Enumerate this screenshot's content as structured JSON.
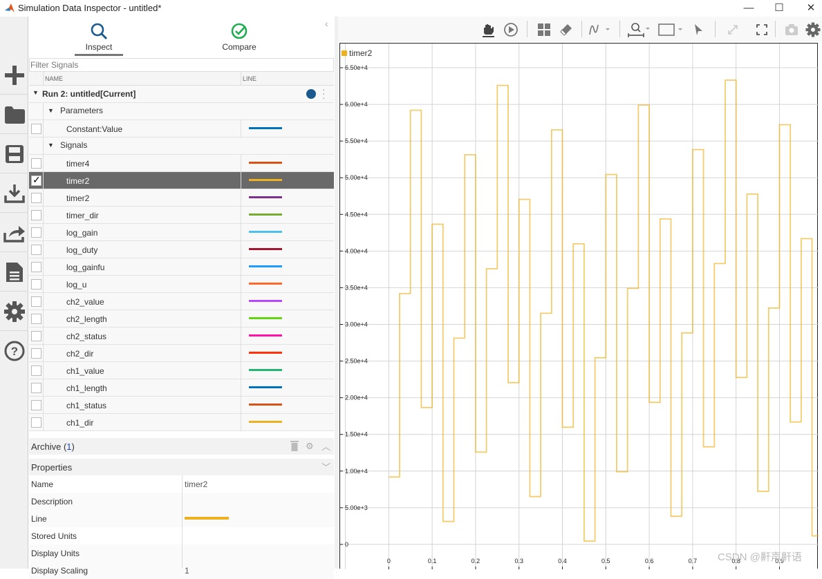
{
  "window": {
    "title": "Simulation Data Inspector - untitled*",
    "minimize": "—",
    "maximize": "☐",
    "close": "✕"
  },
  "sidebar": {
    "icons": [
      "plus-icon",
      "folder-icon",
      "save-icon",
      "download-icon",
      "share-icon",
      "document-icon",
      "gear-icon",
      "help-icon"
    ]
  },
  "tabs": [
    {
      "label": "Inspect",
      "icon": "search-icon",
      "active": true
    },
    {
      "label": "Compare",
      "icon": "check-circle-icon",
      "active": false
    }
  ],
  "filter": {
    "placeholder": "Filter Signals"
  },
  "table": {
    "col_name": "NAME",
    "col_line": "LINE"
  },
  "run": {
    "label": "Run 2: untitled[Current]",
    "dot_color": "#1a5a8f"
  },
  "groups": {
    "parameters": "Parameters",
    "signals": "Signals"
  },
  "parameters": [
    {
      "name": "Constant:Value",
      "color": "#0072bd",
      "checked": false
    }
  ],
  "signals": [
    {
      "name": "timer4",
      "color": "#d95319",
      "checked": false
    },
    {
      "name": "timer2",
      "color": "#edb120",
      "checked": true
    },
    {
      "name": "timer2",
      "color": "#7e2f8e",
      "checked": false
    },
    {
      "name": "timer_dir",
      "color": "#77ac30",
      "checked": false
    },
    {
      "name": "log_gain",
      "color": "#4dbeee",
      "checked": false
    },
    {
      "name": "log_duty",
      "color": "#a2142f",
      "checked": false
    },
    {
      "name": "log_gainfu",
      "color": "#1e9bff",
      "checked": false
    },
    {
      "name": "log_u",
      "color": "#ff6929",
      "checked": false
    },
    {
      "name": "ch2_value",
      "color": "#b746ff",
      "checked": false
    },
    {
      "name": "ch2_length",
      "color": "#64d413",
      "checked": false
    },
    {
      "name": "ch2_status",
      "color": "#ff13a6",
      "checked": false
    },
    {
      "name": "ch2_dir",
      "color": "#fe330a",
      "checked": false
    },
    {
      "name": "ch1_value",
      "color": "#22b573",
      "checked": false
    },
    {
      "name": "ch1_length",
      "color": "#0072bd",
      "checked": false
    },
    {
      "name": "ch1_status",
      "color": "#d95319",
      "checked": false
    },
    {
      "name": "ch1_dir",
      "color": "#edb120",
      "checked": false
    }
  ],
  "archive": {
    "label": "Archive (",
    "count": "1",
    "close": ")"
  },
  "properties": {
    "title": "Properties",
    "rows": [
      {
        "key": "Name",
        "value": "timer2"
      },
      {
        "key": "Description",
        "value": ""
      },
      {
        "key": "Line",
        "value": "",
        "line_color": "#edb120"
      },
      {
        "key": "Stored Units",
        "value": ""
      },
      {
        "key": "Display Units",
        "value": ""
      },
      {
        "key": "Display Scaling",
        "value": "1"
      }
    ]
  },
  "toolbar": {
    "icons": [
      "pan-icon",
      "replay-icon",
      "layout-grid-icon",
      "eraser-icon",
      "signal-icon",
      "zoom-icon",
      "fit-to-view-icon",
      "cursor-icon",
      "expand-icon",
      "fullscreen-icon",
      "camera-icon",
      "settings-icon"
    ]
  },
  "watermark": "CSDN @鼾声鼾语",
  "chart_data": {
    "type": "line",
    "step": true,
    "legend": [
      {
        "name": "timer2",
        "color": "#edb120"
      }
    ],
    "legend_placement": "top-left",
    "grid": true,
    "xlim": [
      -0.112,
      0.99
    ],
    "ylim": [
      -3400,
      68300
    ],
    "xticks": [
      0,
      0.1,
      0.2,
      0.3,
      0.4,
      0.5,
      0.6,
      0.7,
      0.8,
      0.9
    ],
    "xtick_labels": [
      "0",
      "0.1",
      "0.2",
      "0.3",
      "0.4",
      "0.5",
      "0.6",
      "0.7",
      "0.8",
      "0.9"
    ],
    "yticks": [
      0,
      5000,
      10000,
      15000,
      20000,
      25000,
      30000,
      35000,
      40000,
      45000,
      50000,
      55000,
      60000,
      65000
    ],
    "ytick_labels": [
      "0",
      "5.00e+3",
      "1.00e+4",
      "1.50e+4",
      "2.00e+4",
      "2.50e+4",
      "3.00e+4",
      "3.50e+4",
      "4.00e+4",
      "4.50e+4",
      "5.00e+4",
      "5.50e+4",
      "6.00e+4",
      "6.50e+4"
    ],
    "series": [
      {
        "name": "timer2",
        "color": "#edb120",
        "x_start": 0,
        "x_step": 0.025,
        "values": [
          9200,
          34200,
          59200,
          18664,
          43664,
          3128,
          28128,
          53128,
          12592,
          37592,
          62592,
          22056,
          47056,
          6520,
          31520,
          56520,
          15984,
          40984,
          448,
          25448,
          50448,
          9912,
          34912,
          59912,
          19376,
          44376,
          3840,
          28840,
          53840,
          13304,
          38304,
          63304,
          22768,
          47768,
          7232,
          32232,
          57232,
          16696,
          41696,
          1160
        ]
      }
    ]
  }
}
